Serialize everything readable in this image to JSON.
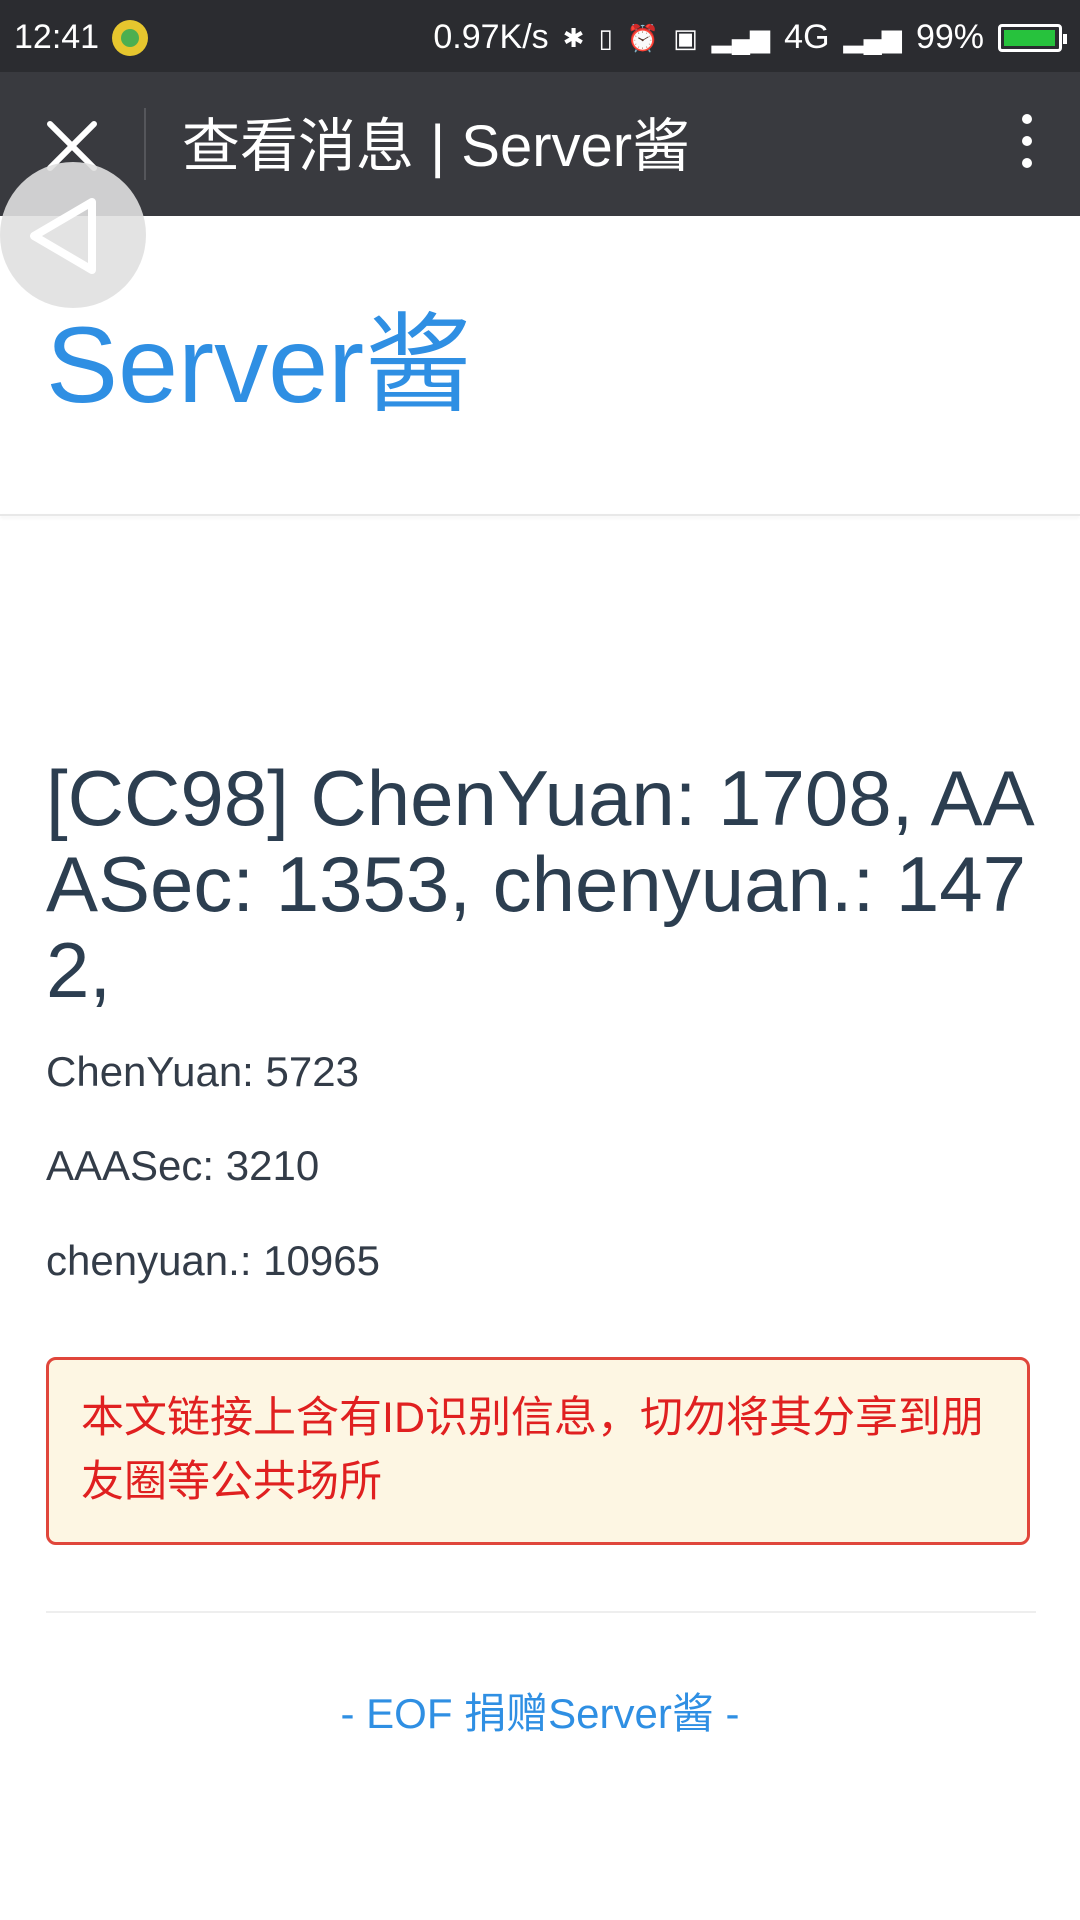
{
  "status_bar": {
    "time": "12:41",
    "net_speed": "0.97K/s",
    "network": "4G",
    "battery": "99%",
    "battery_level": 0.99
  },
  "title_bar": {
    "title": "查看消息 | Server酱"
  },
  "site": {
    "logo": "Server酱"
  },
  "message": {
    "title": "[CC98] ChenYuan: 1708, AAASec: 1353, chenyuan.: 1472,",
    "lines": [
      "ChenYuan: 5723",
      "AAASec: 3210",
      "chenyuan.: 10965"
    ]
  },
  "warning": {
    "text": "本文链接上含有ID识别信息，切勿将其分享到朋友圈等公共场所"
  },
  "footer": {
    "link": "- EOF 捐赠Server酱 -"
  },
  "colors": {
    "accent": "#2f8fe3",
    "warning_border": "#e0463b",
    "warning_text": "#e02020",
    "warning_bg": "#fdf6e3"
  }
}
